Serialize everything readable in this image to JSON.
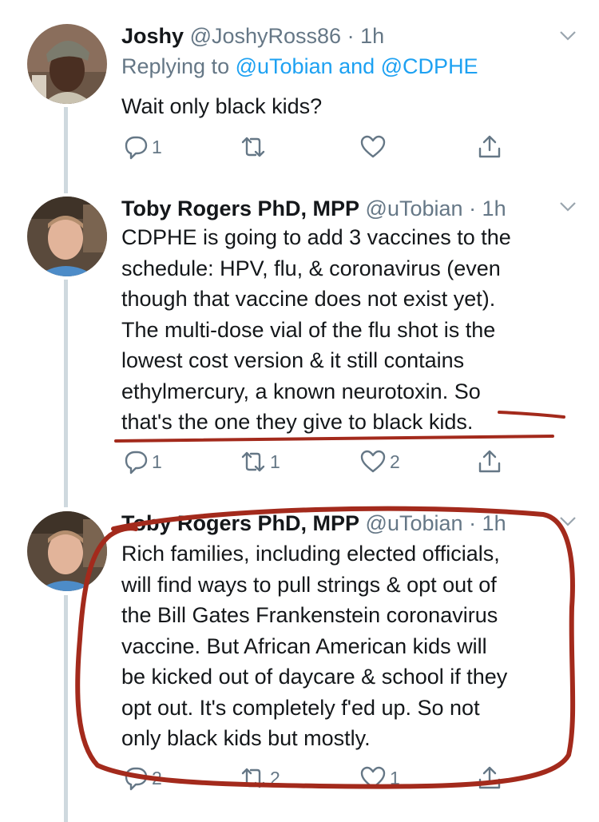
{
  "tweets": [
    {
      "name": "Joshy",
      "handle": "@JoshyRoss86",
      "time": "· 1h",
      "replying_prefix": "Replying to",
      "replying_to": "@uTobian and @CDPHE",
      "lines": [
        "Wait only black kids?"
      ],
      "actions": {
        "reply": "1",
        "retweet": "",
        "like": ""
      }
    },
    {
      "name": "Toby Rogers PhD, MPP",
      "handle": "@uTobian",
      "time": "· 1h",
      "lines": [
        "CDPHE is going to add 3 vaccines to the",
        "schedule: HPV, flu, & coronavirus (even",
        "though that vaccine does not exist yet).",
        "The multi-dose vial of the flu shot is the",
        "lowest cost version & it still contains",
        "ethylmercury, a known neurotoxin. So",
        "that's the one they give to black kids."
      ],
      "actions": {
        "reply": "1",
        "retweet": "1",
        "like": "2"
      }
    },
    {
      "name": "Toby Rogers PhD, MPP",
      "handle": "@uTobian",
      "time": "· 1h",
      "lines": [
        "Rich families, including elected officials,",
        "will find ways to pull strings & opt out of",
        "the Bill Gates Frankenstein coronavirus",
        "vaccine. But African American kids will",
        "be kicked out of daycare & school if they",
        "opt out. It's completely f'ed up. So not",
        "only black kids but mostly."
      ],
      "actions": {
        "reply": "2",
        "retweet": "2",
        "like": "1"
      }
    }
  ],
  "colors": {
    "text": "#14171a",
    "secondary": "#657786",
    "link": "#1da1f2",
    "thread_line": "#cfd9de",
    "annotation": "#a32a1c"
  },
  "icons": [
    "reply-icon",
    "retweet-icon",
    "like-icon",
    "share-icon",
    "chevron-down-icon"
  ]
}
